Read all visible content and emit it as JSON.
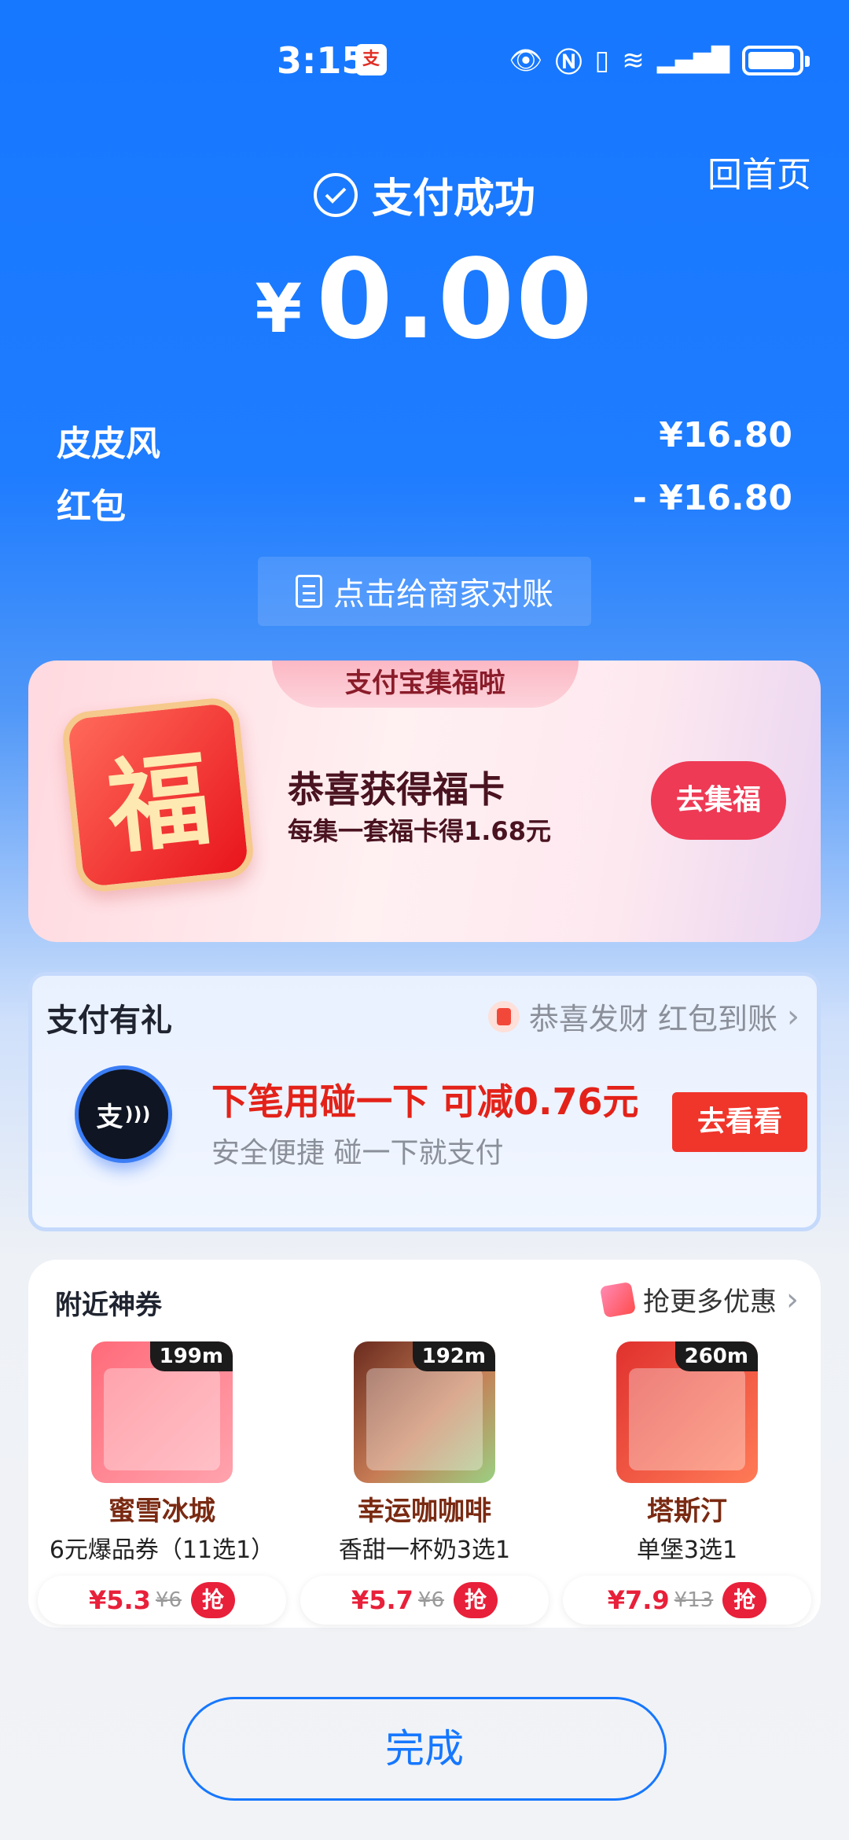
{
  "status_bar": {
    "time": "3:15",
    "app_icon": "支",
    "icons": [
      "eye-icon",
      "nfc-icon",
      "vibrate-icon",
      "wifi-icon",
      "4g-signal-icon",
      "battery-icon"
    ]
  },
  "header": {
    "home_link": "回首页",
    "title": "支付成功",
    "currency": "¥",
    "amount": "0.00"
  },
  "details": [
    {
      "label": "皮皮风",
      "value": "¥16.80"
    },
    {
      "label": "红包",
      "value": "- ¥16.80"
    }
  ],
  "reconcile_button": "点击给商家对账",
  "fu_card": {
    "tab": "支付宝集福啦",
    "badge_char": "福",
    "title": "恭喜获得福卡",
    "subtitle": "每集一套福卡得1.68元",
    "button": "去集福"
  },
  "gift_card": {
    "title": "支付有礼",
    "notice": "恭喜发财 红包到账",
    "icon_text": "支",
    "main": "下笔用碰一下 可减0.76元",
    "sub": "安全便捷 碰一下就支付",
    "button": "去看看"
  },
  "coupons": {
    "title": "附近神券",
    "more": "抢更多优惠",
    "items": [
      {
        "distance": "199m",
        "name": "蜜雪冰城",
        "desc": "6元爆品券（11选1）",
        "price": "¥5.3",
        "old_price": "¥6",
        "grab": "抢"
      },
      {
        "distance": "192m",
        "name": "幸运咖咖啡",
        "desc": "香甜一杯奶3选1",
        "price": "¥5.7",
        "old_price": "¥6",
        "grab": "抢"
      },
      {
        "distance": "260m",
        "name": "塔斯汀",
        "desc": "单堡3选1",
        "price": "¥7.9",
        "old_price": "¥13",
        "grab": "抢"
      }
    ]
  },
  "done_button": "完成",
  "colors": {
    "brand_blue": "#1677ff",
    "red": "#e8203a",
    "fu_button": "#ee3a55"
  }
}
